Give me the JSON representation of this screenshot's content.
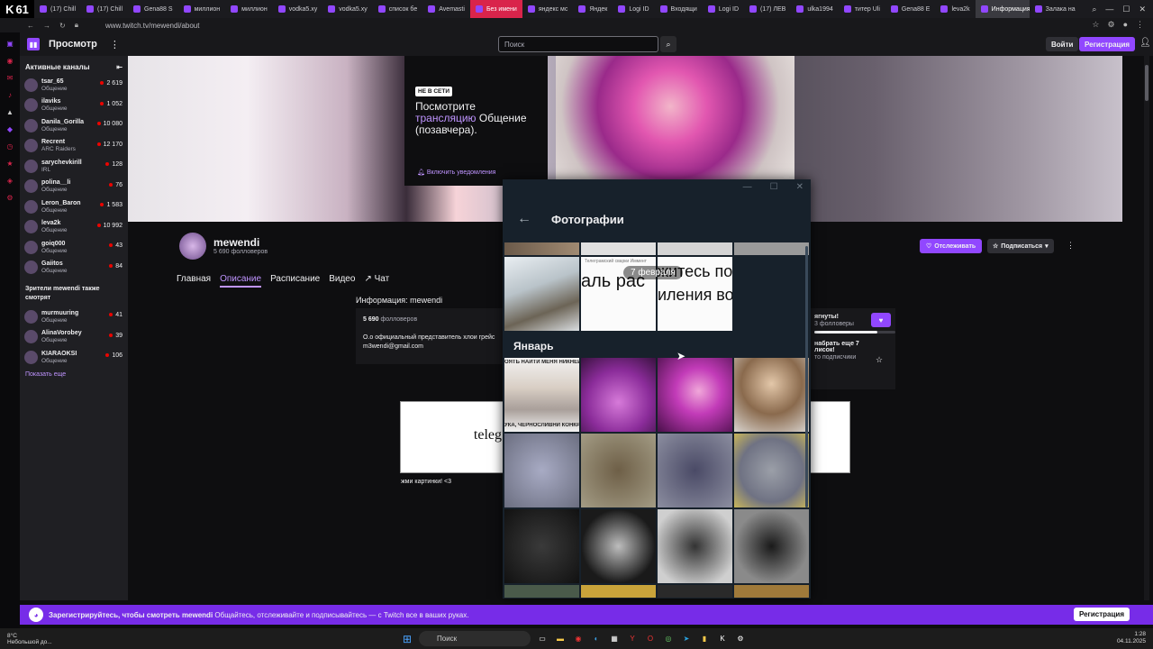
{
  "browser": {
    "counter": "61",
    "tabs": [
      {
        "label": "(17) Chill"
      },
      {
        "label": "(17) Chill"
      },
      {
        "label": "Gena88 S"
      },
      {
        "label": "миллион"
      },
      {
        "label": "миллион"
      },
      {
        "label": "vodka5.xy"
      },
      {
        "label": "vodka5.xy"
      },
      {
        "label": "список бе"
      },
      {
        "label": "Avemasti"
      },
      {
        "label": "Без имени"
      },
      {
        "label": "яндекс мс"
      },
      {
        "label": "Яндек"
      },
      {
        "label": "Logi ID"
      },
      {
        "label": "Входящи"
      },
      {
        "label": "Logi ID"
      },
      {
        "label": "(17) ЛЕВ"
      },
      {
        "label": "ulka1994"
      },
      {
        "label": "титер Uli"
      },
      {
        "label": "Gena88 E"
      },
      {
        "label": "leva2k"
      },
      {
        "label": "Информация: п"
      },
      {
        "label": "Залака на"
      }
    ],
    "url": "www.twitch.tv/mewendi/about"
  },
  "nav": {
    "browse": "Просмотр",
    "search_placeholder": "Поиск",
    "login": "Войти",
    "signup": "Регистрация"
  },
  "sidebar": {
    "title": "Активные каналы",
    "channels": [
      {
        "name": "tsar_65",
        "game": "Общение",
        "viewers": "2 619"
      },
      {
        "name": "ilaviks",
        "game": "Общение",
        "viewers": "1 052"
      },
      {
        "name": "Danila_Gorilla",
        "game": "Общение",
        "viewers": "10 080"
      },
      {
        "name": "Recrent",
        "game": "ARC Raiders",
        "viewers": "12 170"
      },
      {
        "name": "sarychevkirill",
        "game": "IRL",
        "viewers": "128"
      },
      {
        "name": "polina__li",
        "game": "Общение",
        "viewers": "76"
      },
      {
        "name": "Leron_Baron",
        "game": "Общение",
        "viewers": "1 583"
      },
      {
        "name": "leva2k",
        "game": "Общение",
        "viewers": "10 992"
      },
      {
        "name": "goiq000",
        "game": "Общение",
        "viewers": "43"
      },
      {
        "name": "Gaiitos",
        "game": "Общение",
        "viewers": "84"
      }
    ],
    "also_title": "Зрители mewendi также смотрят",
    "also": [
      {
        "name": "murmuuring",
        "game": "Общение",
        "viewers": "41"
      },
      {
        "name": "AlinaVorobey",
        "game": "Общение",
        "viewers": "39"
      },
      {
        "name": "KIARAOKSI",
        "game": "Общение",
        "viewers": "106"
      }
    ],
    "show_more": "Показать еще"
  },
  "offline": {
    "badge": "НЕ В СЕТИ",
    "line1": "Посмотрите",
    "link": "трансляцию",
    "line2": "Общение",
    "line3": "(позавчера).",
    "notify": "Включить уведомления"
  },
  "profile": {
    "name": "mewendi",
    "followers": "5 690 фолловеров",
    "tabs": [
      "Главная",
      "Описание",
      "Расписание",
      "Видео",
      "Чат"
    ],
    "follow": "Отслеживать",
    "subscribe": "Подписаться",
    "info_title": "Информация: mewendi",
    "info_followers_num": "5 690",
    "info_followers_word": "фолловеров",
    "info_bio": "О.о официальный представитель хлои грейс",
    "info_email": "m3wendi@gmail.com",
    "card_text": "teleg",
    "card_caption": "жми картинки! <3",
    "right_line1": "ягнуты!",
    "right_line2": "3 фолловеры",
    "right_line3": "набрать еще 7",
    "right_line4": "лисок!",
    "right_line5": "то подписчики"
  },
  "dialog": {
    "title": "Фотографии",
    "date_pill": "7 февраля",
    "thumb_text1": "аль рас",
    "thumb_text2": "житесь по",
    "thumb_text3": "иления во",
    "thumb_header": "Телеграмский сварки Иммент",
    "month": "Январь",
    "meme_top": "ОЯТЬ НАЙТИ МЕНЯ НИКНЕЙМ",
    "meme_bottom": "УКА, ЧЕРНОСЛИВНИ КОНКРЕТН"
  },
  "promo": {
    "bold": "Зарегистрируйтесь, чтобы смотреть mewendi",
    "text": "Общайтесь, отслеживайте и подписывайтесь — с Twitch все в ваших руках.",
    "button": "Регистрация"
  },
  "taskbar": {
    "temp": "8°C",
    "weather": "Небольшой до...",
    "search": "Поиск",
    "time": "1:28",
    "date": "04.11.2025"
  }
}
